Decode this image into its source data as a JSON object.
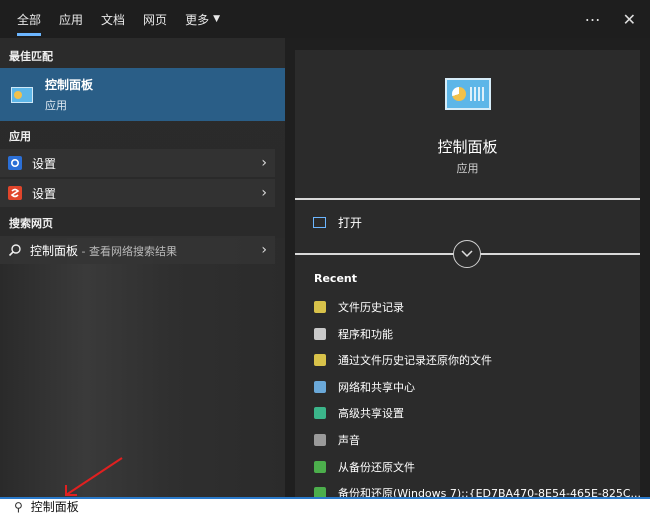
{
  "tabs": [
    "全部",
    "应用",
    "文档",
    "网页",
    "更多"
  ],
  "topbar": {
    "more_icon": "⋯",
    "close_icon": "✕"
  },
  "left": {
    "best_match_title": "最佳匹配",
    "best_match": {
      "name": "控制面板",
      "type": "应用"
    },
    "apps_title": "应用",
    "apps": [
      {
        "label": "设置"
      },
      {
        "label": "设置"
      }
    ],
    "web_title": "搜索网页",
    "web_item": {
      "label": "控制面板",
      "suffix": " - 查看网络搜索结果"
    }
  },
  "detail": {
    "title": "控制面板",
    "subtitle": "应用",
    "open_label": "打开",
    "recent_title": "Recent",
    "recent": [
      "文件历史记录",
      "程序和功能",
      "通过文件历史记录还原你的文件",
      "网络和共享中心",
      "高级共享设置",
      "声音",
      "从备份还原文件",
      "备份和还原(Windows 7)::{ED7BA470-8E54-465E-825C..."
    ]
  },
  "search": {
    "value": "控制面板"
  },
  "colors": {
    "accent": "#6cb6ff",
    "highlight": "#2a5e87",
    "search_border": "#2a7acb",
    "arrow": "#e02020"
  }
}
